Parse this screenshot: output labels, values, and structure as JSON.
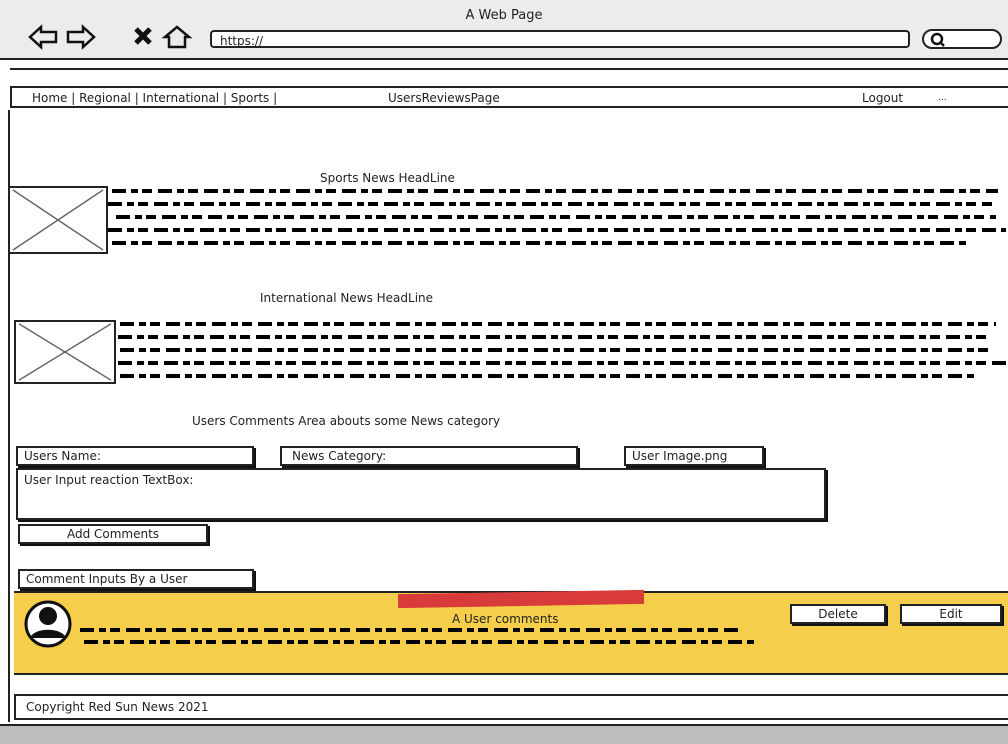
{
  "window": {
    "title": "A Web Page"
  },
  "browser": {
    "url": "https://"
  },
  "nav": {
    "items_text": "Home | Regional | International | Sports   |",
    "reviews": "UsersReviewsPage",
    "logout": "Logout",
    "more": "..."
  },
  "sports": {
    "headline": "Sports News HeadLine"
  },
  "international": {
    "headline": "International News HeadLine"
  },
  "comments_area": {
    "title": "Users Comments Area abouts some News category"
  },
  "form": {
    "name_label": "Users Name:",
    "category_label": "News Category:",
    "image_label": "User Image.png",
    "textbox_label": "User Input reaction TextBox:",
    "add_button": "Add Comments"
  },
  "comment_section": {
    "tab": "Comment Inputs By  a User"
  },
  "comment": {
    "title": "A User comments",
    "delete": "Delete",
    "edit": "Edit"
  },
  "footer": {
    "copyright": "Copyright Red Sun News 2021"
  },
  "colors": {
    "comment_bg": "#f5cf4c",
    "marker": "#d93a3a"
  }
}
